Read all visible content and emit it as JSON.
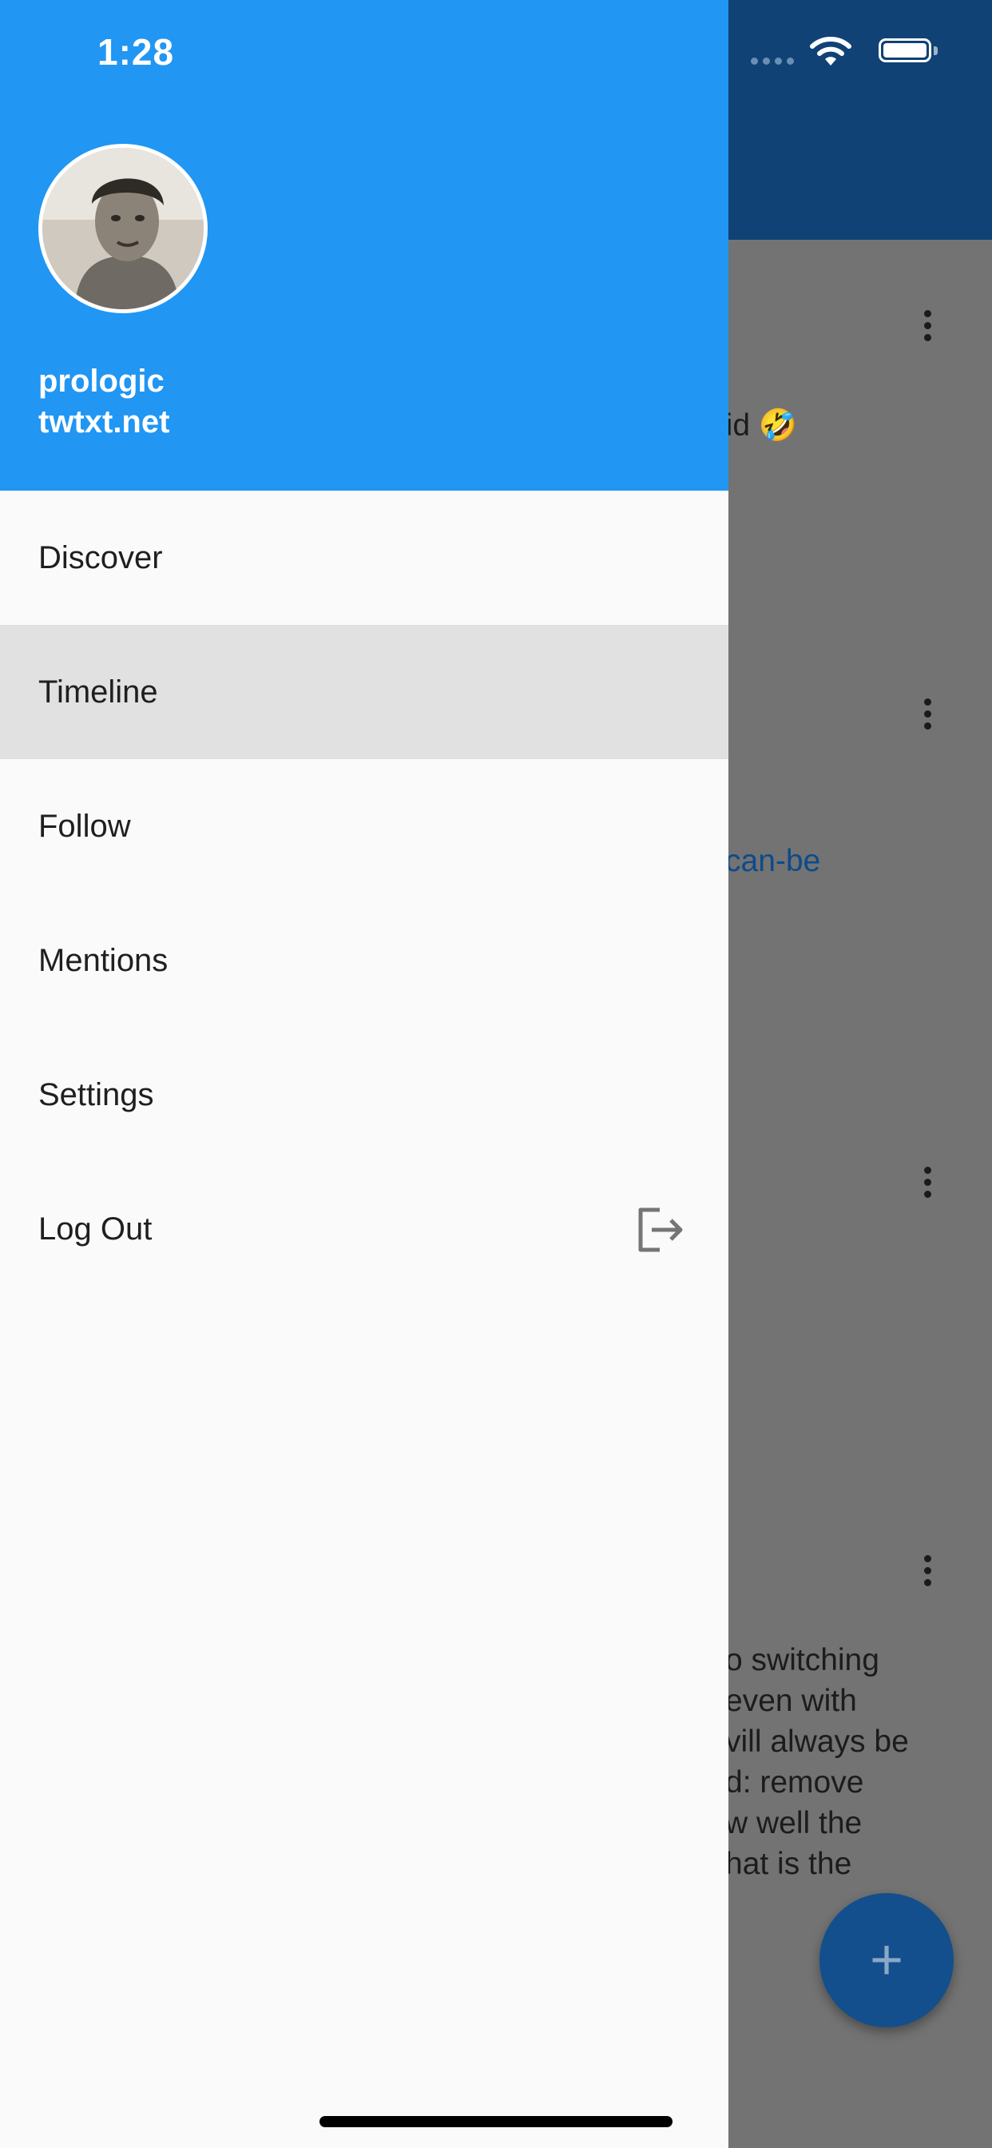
{
  "status_bar": {
    "time": "1:28"
  },
  "drawer": {
    "user": {
      "name": "prologic",
      "host": "twtxt.net"
    },
    "menu": [
      {
        "label": "Discover"
      },
      {
        "label": "Timeline"
      },
      {
        "label": "Follow"
      },
      {
        "label": "Mentions"
      },
      {
        "label": "Settings"
      },
      {
        "label": "Log Out",
        "icon": "logout-icon"
      }
    ],
    "active_item": "Timeline",
    "header_color": "#2196f3"
  },
  "background": {
    "appbar_color": "#104275",
    "snippets": {
      "s1": "lid 🤣",
      "s2": "can-be",
      "s3": "o switching\neven with\nvill always be\nd: remove\nw well the\nhat is the"
    },
    "fab_label": "+"
  }
}
